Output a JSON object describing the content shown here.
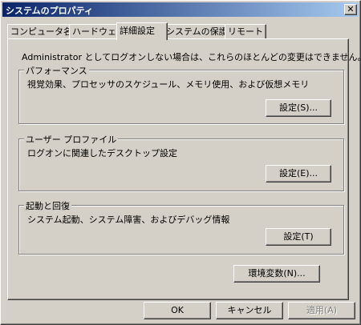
{
  "window": {
    "title": "システムのプロパティ"
  },
  "tabs": [
    {
      "label": "コンピュータ名"
    },
    {
      "label": "ハードウェア"
    },
    {
      "label": "詳細設定"
    },
    {
      "label": "システムの保護"
    },
    {
      "label": "リモート"
    }
  ],
  "panel": {
    "description": "Administrator としてログオンしない場合は、これらのほとんどの変更はできません。",
    "performance": {
      "title": "パフォーマンス",
      "text": "視覚効果、プロセッサのスケジュール、メモリ使用、および仮想メモリ",
      "button": "設定(S)..."
    },
    "profile": {
      "title": "ユーザー プロファイル",
      "text": "ログオンに関連したデスクトップ設定",
      "button": "設定(E)..."
    },
    "startup": {
      "title": "起動と回復",
      "text": "システム起動、システム障害、およびデバッグ情報",
      "button": "設定(T)"
    },
    "env_button": "環境変数(N)..."
  },
  "footer": {
    "ok": "OK",
    "cancel": "キャンセル",
    "apply": "適用(A)"
  }
}
